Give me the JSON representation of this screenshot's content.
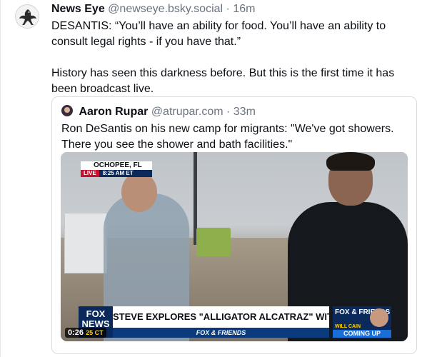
{
  "post": {
    "author": "News Eye",
    "handle": "@newseye.bsky.social",
    "separator": "·",
    "time": "16m",
    "avatar_icon": "eagle-icon",
    "paragraph_1": "DESANTIS: “You’ll have an ability for food. You’ll have an ability to consult legal rights - if you have that.”",
    "paragraph_2": "History has seen this darkness before. But this is the first time it has been broadcast live."
  },
  "quote": {
    "author": "Aaron Rupar",
    "handle": "@atrupar.com",
    "separator": "·",
    "time": "33m",
    "text": "Ron DeSantis on his new camp for migrants: \"We've got showers. There you see the shower and bath facilities.\"",
    "video": {
      "location": "OCHOPEE, FL",
      "live_label": "LIVE",
      "clock": "8:25 AM ET",
      "network_logo": "FOX NEWS",
      "headline": "STEVE EXPLORES \"ALLIGATOR ALCATRAZ\" WITH DESANTIS",
      "show_name": "FOX & FRIENDS",
      "promo_logo": "FOX & FRIENDS",
      "promo_host": "WILL CAIN",
      "promo_status": "COMING UP",
      "timecode": "0:26",
      "temperature": "25 CT"
    }
  },
  "colors": {
    "text": "#0b0f14",
    "muted": "#6b7280",
    "border": "#d8dde3",
    "fox_red": "#c8102e",
    "fox_navy": "#0b2a5b"
  }
}
